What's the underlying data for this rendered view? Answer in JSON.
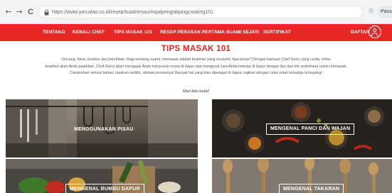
{
  "browser": {
    "back_glyph": "←",
    "forward_glyph": "→",
    "reload_glyph": "C",
    "url": "https://www.yorcalao.co.id/resep/bulat/emas/mpalpengsikpingcooking101",
    "star_glyph": "☆",
    "profile_label": "Paus"
  },
  "nav": {
    "items": [
      {
        "label": "TENTANG"
      },
      {
        "label": "KENALI CHEF"
      },
      {
        "label": "TIPS MASAK 101"
      },
      {
        "label": "RESEP PERASAN PERTAMA SUAMI SEJATI"
      },
      {
        "label": "SERTIFIKAT"
      }
    ],
    "daftar_label": "DAFTAR",
    "brand_color": "#e82827"
  },
  "main": {
    "title": "TIPS MASAK 101",
    "intro_lines": [
      "Cincang, takar, bumbui dan bersihkan. Bagi seorang suami, memasak adalah keahlian yang mustahil. Apa benar? Dengan bantuan Chef Gerry yang cerita, mitos",
      "tersebut akan Anda patahkan. Chef Gerry akan mengajak Anda menyusun resep di dapur dan mengenal cara Anda bekerja di dapur dengan tips dan trik sederhana untuk memasak.",
      "Campurkan semua bahan, rasakan sedikit, nikmati prosesnya! Banyak hal yang bisa dipelajari di dapur, sajikan dengan cinta untuk keluarga tersayang!"
    ],
    "subtitle": "Mari kita mulai!"
  },
  "tiles": [
    {
      "label": "MENGGUNAKAN PISAU",
      "boxed": false
    },
    {
      "label": "MENGENAL PANCI DAN WAJAN",
      "boxed": true
    },
    {
      "label": "MENGENAL BUMBU DAPUR",
      "boxed": true
    },
    {
      "label": "MENGENAL TAKARAN",
      "boxed": true
    }
  ]
}
